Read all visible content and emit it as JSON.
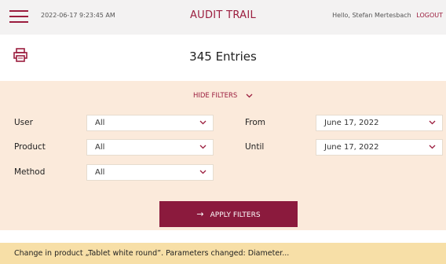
{
  "header": {
    "timestamp": "2022-06-17 9:23:45 AM",
    "title": "AUDIT TRAIL",
    "greeting": "Hello, Stefan Mertesbach",
    "logout_label": "LOGOUT"
  },
  "summary": {
    "entries_label": "345 Entries"
  },
  "filters": {
    "toggle_label": "HIDE FILTERS",
    "user": {
      "label": "User",
      "value": "All"
    },
    "product": {
      "label": "Product",
      "value": "All"
    },
    "method": {
      "label": "Method",
      "value": "All"
    },
    "from": {
      "label": "From",
      "value": "June 17, 2022"
    },
    "until": {
      "label": "Until",
      "value": "June 17, 2022"
    },
    "apply_label": "APPLY FILTERS"
  },
  "entries": [
    {
      "text": "Change in product „Tablet white round”. Parameters changed: Diameter..."
    }
  ],
  "icons": {
    "menu": "hamburger-menu-icon",
    "print": "printer-icon",
    "chevron": "chevron-down-icon",
    "apply": "arrow-right-icon"
  },
  "colors": {
    "accent": "#9b1d3e",
    "button": "#8b1a3d",
    "filter_panel": "#fbeadb",
    "entry_highlight": "#f7dfa7",
    "header_bg": "#f3f2f2"
  }
}
